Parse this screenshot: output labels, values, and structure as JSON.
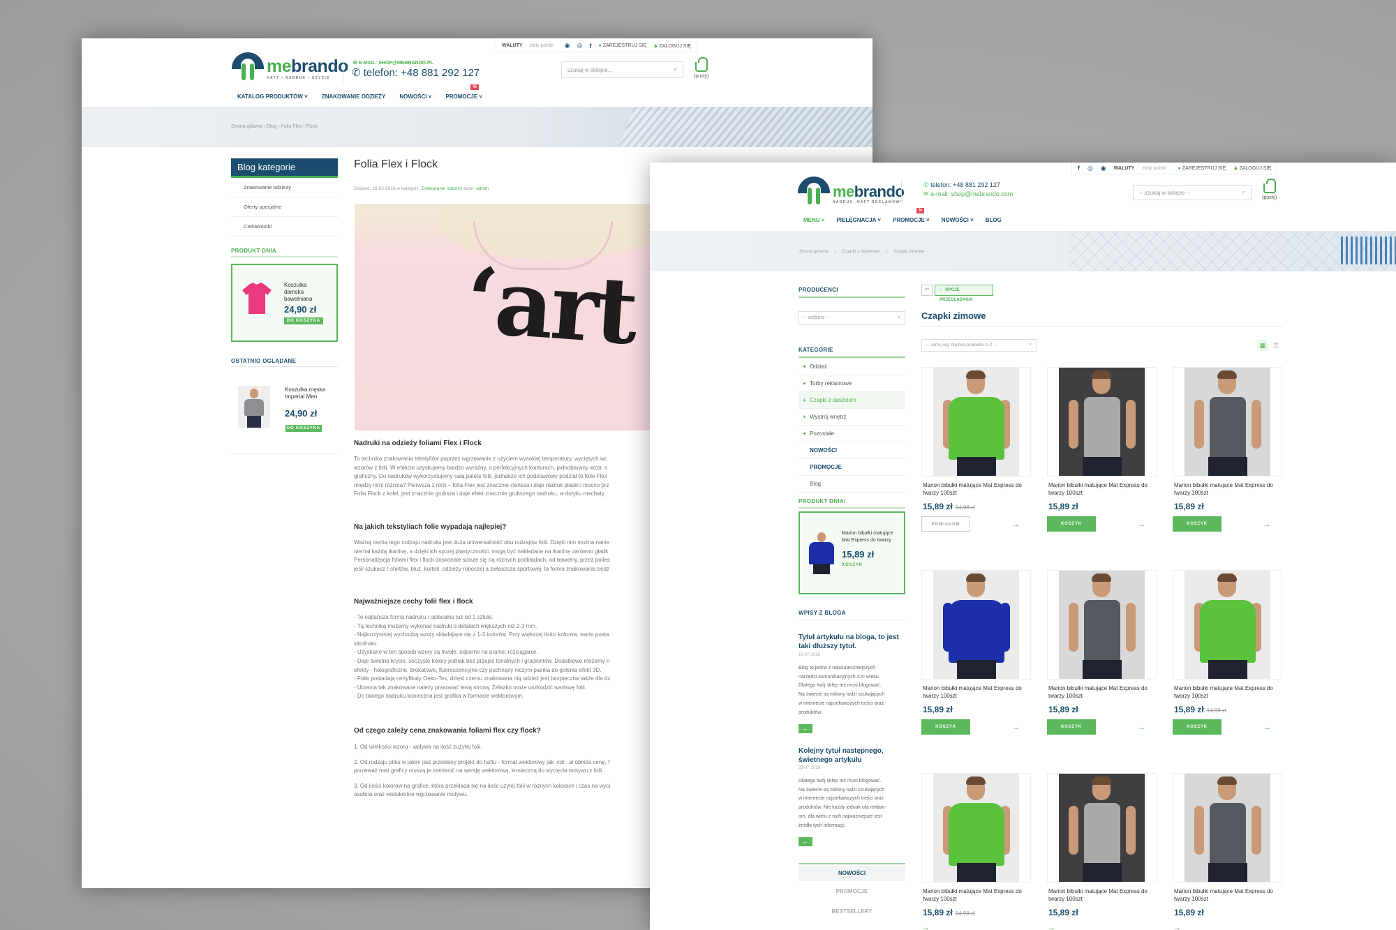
{
  "p1": {
    "logo": {
      "me": "me",
      "brand": "brando",
      "tagline": "HAFT • NADRUK • SZYCIE"
    },
    "topbar": {
      "waluty": "WALUTY",
      "currency": "złoty polski",
      "register": "ZAREJESTRUJ SIĘ",
      "login": "ZALOGUJ SIĘ"
    },
    "contact": {
      "email": "E-MAIL: SHOP@MEBRANDO.PL",
      "phone": "telefon: +48 881 292 127"
    },
    "search_placeholder": "szukaj w sklepie...",
    "cart_label": "(pusty)",
    "nav": [
      "KATALOG PRODUKTÓW",
      "ZNAKOWANIE ODZIEŻY",
      "NOWOŚCI",
      "PROMOCJE"
    ],
    "promo_badge": "%",
    "breadcrumb": "Strona główna  ›  Blog  ›  Folia Flex i Flock",
    "sidebar": {
      "blog_title": "Blog kategorie",
      "blog_items": [
        "Znakowanie odzieży",
        "Oferty specjalne",
        "Ciekawostki"
      ],
      "produkt_dnia": "PRODUKT DNIA",
      "pd_name": "Koszulka damska bawełniana",
      "pd_price": "24,90 zł",
      "pd_btn": "DO KOSZYKA",
      "ostatnio": "OSTATNIO OGLĄDANE",
      "os_name": "Koszulka męska Imperial Men",
      "os_price": "24,90 zł",
      "os_btn": "DO KOSZYKA"
    },
    "article": {
      "title": "Folia Flex i Flock",
      "meta_prefix": "Dodano: 16-02-2019 w kategorii: ",
      "meta_cat": "Znakowanie odzieży",
      "meta_mid": " autor: ",
      "meta_author": "admin",
      "hero_text": "‘art",
      "s1_h": "Nadruki na odzieży foliami Flex i Flock",
      "s1_p": [
        "To technika znakowania tekstyliów poprzez wgrzewanie z użyciem wysokiej temperatury, wyciętych wc",
        "wzorów z folii. W efekcie uzyskujemy bardzo wyraźny, o perfekcyjnych konturach, jednobarwny wzór, n",
        "graficzny. Do nadruków wykorzystujemy całą paletę folii, jednakże ich podstawowy podział to folie Flex",
        "między nimi różnica? Pierwsza z nich – folia Flex jest znacznie cieńsza i daje nadruk płaski i mocno prz",
        "Folia Flock z kolei, jest znacznie grubsza i daje efekt znacznie grubszego nadruku, w dotyku mechaty."
      ],
      "s2_h": "Na jakich tekstyliach folie wypadają najlepiej?",
      "s2_p": [
        "Ważną cechą tego rodzaju nadruku jest duża uniwersalność obu rodzajów folii. Dzięki nim można nanie",
        "niemal każdą tkaninę, a dzięki ich sporej plastyczności, mogą być nakładane na tkaninę zarówno gładk",
        "Personalizacja foliami flex i flock doskonale spisze się na różnych podkładach, od bawełny, przez polies",
        "jeśli szukasz t-shirtów, bluz, kurtek, odzieży roboczej a zwłaszcza sportowej, ta forma znakowania będz"
      ],
      "s3_h": "Najważniejsze cechy folii flex i flock",
      "s3_p": [
        "- To najtańsza forma nadruku i opłacalna już od 1 sztuki.",
        "- Tą techniką możemy wykonać nadruki o detalach większych niż 2-3 mm.",
        "- Najkorzystniej wychodzą wzory składające się z 1-3 kolorów. Przy większej ilości kolorów, warto posta",
        "sitodruku.",
        "- Uzyskane w ten sposób wzory są trwałe, odporne na pranie, rozciąganie.",
        "- Daje świetne krycie, soczyste kolory jednak bez przejść tonalnych i gradientów. Dodatkowo możemy n",
        "efekty - holograficzne, brokatowe, fluorescencyjne czy puchnący niczym pianka do golenia efekt 3D.",
        "- Folie posiadają certyfikaty Oeko-Tex, dzięki czemu znakowana nią odzież jest bezpieczna także dla dz",
        "- Ubrania tak znakowane należy prasować lewą stroną. Żelazko może uszkodzić wartswę folii.",
        "- Do takiego nadruku konieczna jest grafika w formacie wektorowym."
      ],
      "s4_h": "Od czego zależy cena znakowania foliami flex czy flock?",
      "s4_p1": "1. Od wielkości wzoru - wpływa na ilość zużytej folii.",
      "s4_p2": [
        "2. Od rodzaju pliku w jakim jest przesłany projekt do haftu - format wektorowy jak .cdr, .ai obniża cenę, f",
        "ponieważ nasi graficy muszą je zamienić na wersję wektorową, konieczną do wycięcia motywu z folii."
      ],
      "s4_p3": [
        "3. Od ilości kolorów na grafice, która przekłada się na ilość użytej folii w różnych kolorach i czas na wyci",
        "osobna oraz wielokrotne wgrzewanie motywu."
      ]
    }
  },
  "p2": {
    "logo": {
      "me": "me",
      "brand": "brando",
      "tagline": "NADRUK, HAFT REKLAMOWY"
    },
    "topbar": {
      "waluty": "WALUTY",
      "currency": "złoty polski",
      "register": "ZAREJESTRUJ SIĘ",
      "login": "ZALOGUJ SIĘ"
    },
    "contact": {
      "phone": "telefon: +48 881 292 127",
      "email": "e-mail: shop@mebrando.com"
    },
    "search_placeholder": "-- szukaj w sklepie --",
    "cart_label": "(pusty)",
    "nav": [
      "MENU",
      "PIELĘGNACJA",
      "PROMOCJE",
      "NOWOŚCI",
      "BLOG"
    ],
    "promo_badge": "%",
    "breadcrumb": "Strona główna     /     Czapki z daszkiem     /     Czapki zimowe",
    "sidebar": {
      "producenci": "PRODUCENCI",
      "select": "-- wybierz --",
      "kategorie": "KATEGORIE",
      "cats": [
        {
          "label": "Odzież",
          "cls": ""
        },
        {
          "label": "Torby reklamowe",
          "cls": ""
        },
        {
          "label": "Czapki z daszkiem",
          "cls": "active"
        },
        {
          "label": "Wystrój wnętrz",
          "cls": ""
        },
        {
          "label": "Pozostałe",
          "cls": ""
        },
        {
          "label": "NOWOŚCI",
          "cls": "bold"
        },
        {
          "label": "PROMOCJE",
          "cls": "bold"
        },
        {
          "label": "Blog",
          "cls": "plain"
        }
      ],
      "produkt_dnia": "PRODUKT DNIA!",
      "pd_name": "Marion bibułki matujące Mat Express do twarzy",
      "pd_price": "15,89 zł",
      "pd_btn": "KOSZYK",
      "wpisy": "WPISY Z BLOGA",
      "post1_title": "Tytuł artykułu na bloga, to jest taki dłuższy tytuł.",
      "post1_date": "10-07-2018",
      "post1_text": [
        "Blog to jedno z najskuteczniejszych",
        "narzędzi komunikacyjnych XXI wieku.",
        "Dlatego twój sklep też musi blogować.",
        "Na świecie są miliony ludzi szukających",
        "w internecie najciekawszych treści oraz",
        "produktów."
      ],
      "post2_title": "Kolejny tytuł następnego, świetnego artykułu",
      "post2_date": "23-07-2018",
      "post2_text": [
        "Dlatego twój sklep też musi blogować.",
        "Na świecie są miliony ludzi szukających",
        "w internecie najciekawszych treści oraz",
        "produktów. Nie każdy jednak ufa reklam-",
        "om, dla wielu z nich najważniejsze jest",
        "źródło tych informacji."
      ],
      "tabs": [
        "NOWOŚCI",
        "PROMOCJE",
        "BESTSELLERY"
      ]
    },
    "main": {
      "options_btn": "OPCJE PRZEGLĄDANIA",
      "title": "Czapki zimowe",
      "sort": "-- sortuj wg: Nazwa produktu A-Z --",
      "products": [
        {
          "name": "Marion bibułki matujące Mat Express do twarzy 100szt",
          "price": "15,89 zł",
          "old": "14,98 zł",
          "btn": "POWIADOM"
        },
        {
          "name": "Marion bibułki matujące Mat Express do twarzy 100szt",
          "price": "15,89 zł",
          "old": "",
          "btn": "KOSZYK"
        },
        {
          "name": "Marion bibułki matujące Mat Express do twarzy 100szt",
          "price": "15,89 zł",
          "old": "",
          "btn": "KOSZYK"
        },
        {
          "name": "Marion bibułki matujące Mat Express do twarzy 100szt",
          "price": "15,89 zł",
          "old": "",
          "btn": "KOSZYK"
        },
        {
          "name": "Marion bibułki matujące Mat Express do twarzy 100szt",
          "price": "15,89 zł",
          "old": "",
          "btn": "KOSZYK"
        },
        {
          "name": "Marion bibułki matujące Mat Express do twarzy 100szt",
          "price": "15,89 zł",
          "old": "14,98 zł",
          "btn": "KOSZYK"
        },
        {
          "name": "Marion bibułki matujące Mat Express do twarzy 100szt",
          "price": "15,89 zł",
          "old": "14,98 zł",
          "btn": ""
        },
        {
          "name": "Marion bibułki matujące Mat Express do twarzy 100szt",
          "price": "15,89 zł",
          "old": "",
          "btn": ""
        },
        {
          "name": "Marion bibułki matujące Mat Express do twarzy 100szt",
          "price": "15,89 zł",
          "old": "",
          "btn": ""
        }
      ]
    },
    "colors": {
      "green": "#4caf50",
      "navy": "#1c4d6e",
      "bright_green_shirt": "#5ac23c",
      "blue_shirt": "#1a2fa8"
    }
  }
}
